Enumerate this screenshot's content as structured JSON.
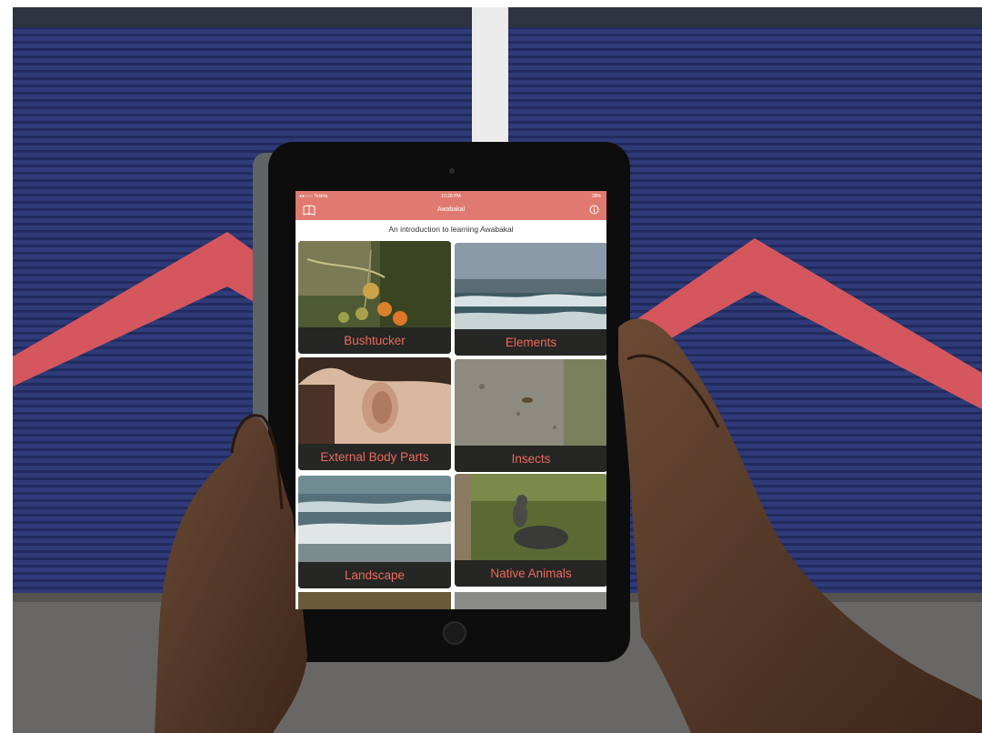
{
  "app": {
    "status": {
      "carrier": "●●○○○ Telstra",
      "time": "10:28 PM",
      "battery": "38%"
    },
    "title": "Awabakal",
    "subtitle": "An introduction to learning Awabakal",
    "icons": {
      "left": "book-icon",
      "right": "info-icon"
    },
    "categories": [
      {
        "label": "Bushtucker"
      },
      {
        "label": "Elements"
      },
      {
        "label": "External Body Parts"
      },
      {
        "label": "Insects"
      },
      {
        "label": "Landscape"
      },
      {
        "label": "Native Animals"
      }
    ]
  },
  "colors": {
    "accent": "#e07a70",
    "label_text": "#ea6a5e",
    "label_bg": "#262624"
  }
}
